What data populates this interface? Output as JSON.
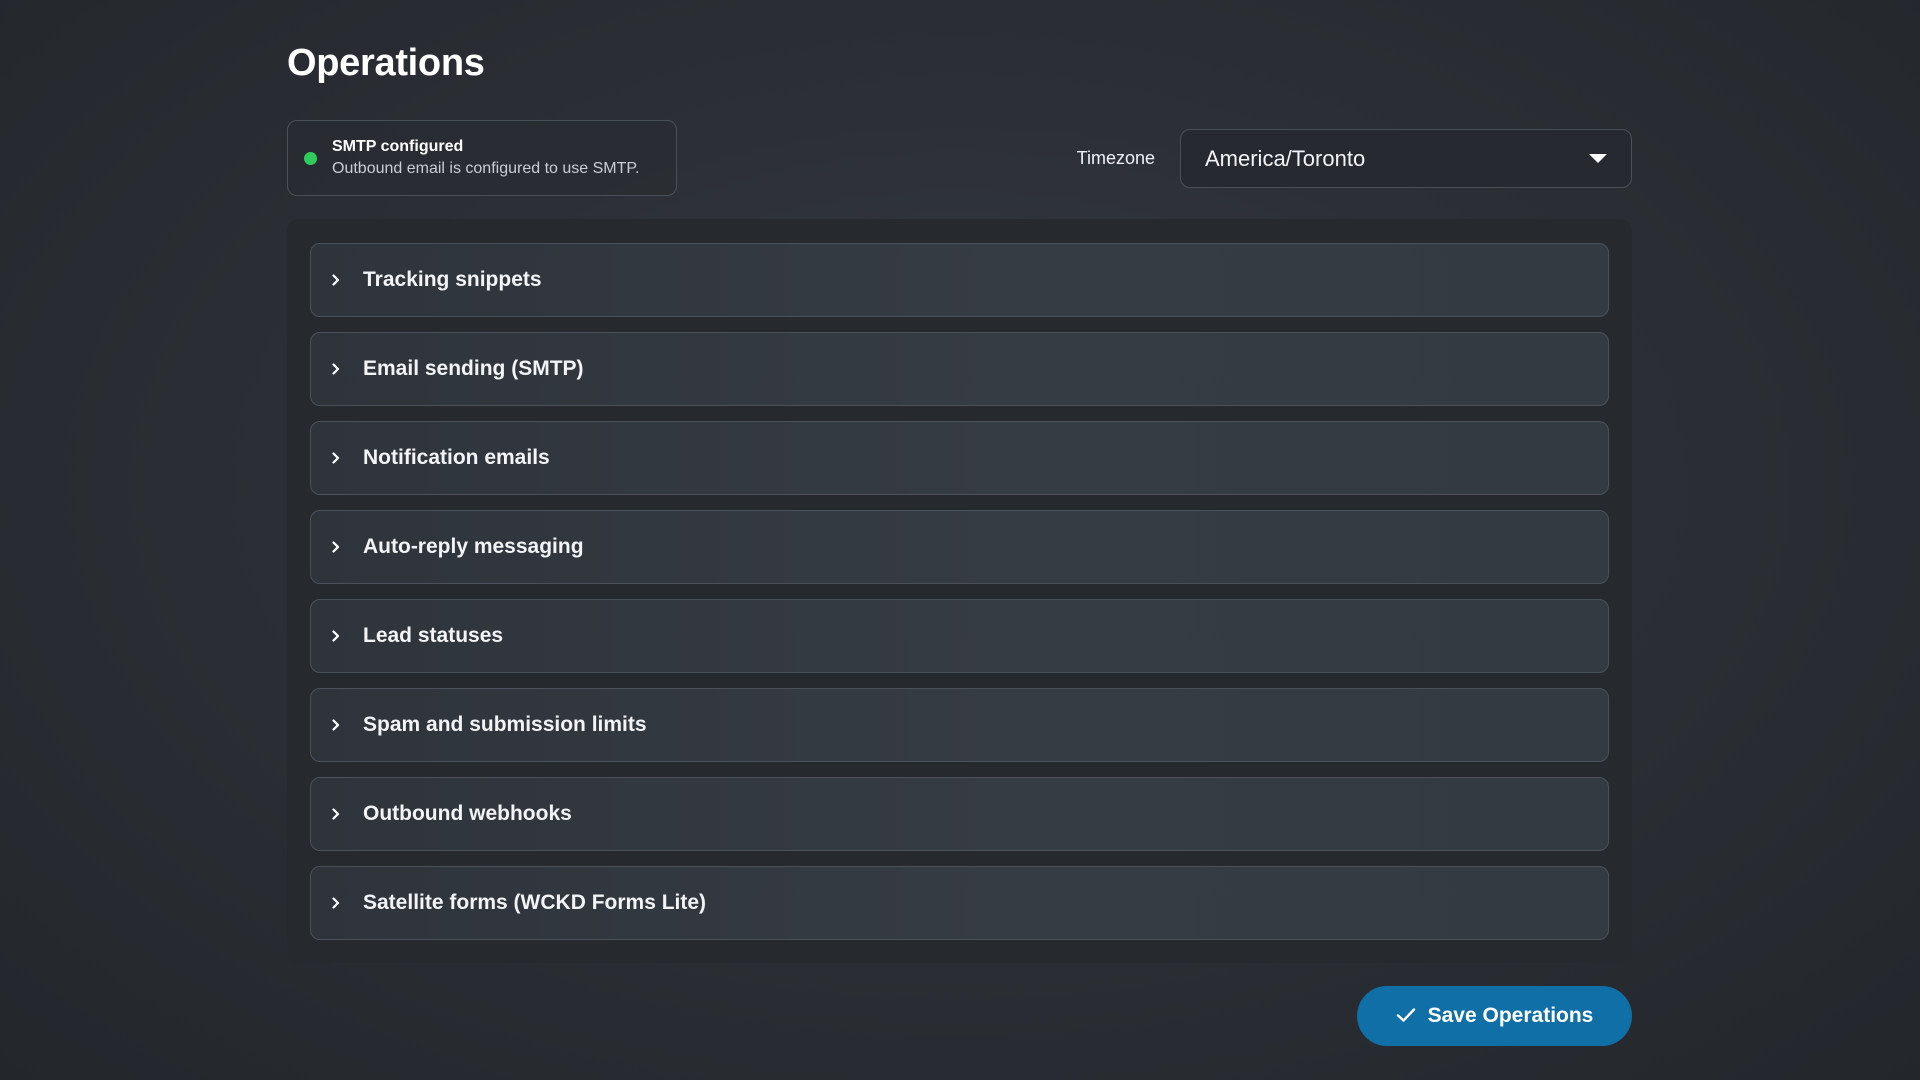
{
  "page": {
    "title": "Operations"
  },
  "smtp_status": {
    "title": "SMTP configured",
    "description": "Outbound email is configured to use SMTP.",
    "status_color": "#2ecc5a"
  },
  "timezone": {
    "label": "Timezone",
    "value": "America/Toronto",
    "icon": "caret-down-icon"
  },
  "sections": [
    {
      "label": "Tracking snippets",
      "icon": "chevron-right-icon",
      "expanded": false
    },
    {
      "label": "Email sending (SMTP)",
      "icon": "chevron-right-icon",
      "expanded": false
    },
    {
      "label": "Notification emails",
      "icon": "chevron-right-icon",
      "expanded": false
    },
    {
      "label": "Auto-reply messaging",
      "icon": "chevron-right-icon",
      "expanded": false
    },
    {
      "label": "Lead statuses",
      "icon": "chevron-right-icon",
      "expanded": false
    },
    {
      "label": "Spam and submission limits",
      "icon": "chevron-right-icon",
      "expanded": false
    },
    {
      "label": "Outbound webhooks",
      "icon": "chevron-right-icon",
      "expanded": false
    },
    {
      "label": "Satellite forms (WCKD Forms Lite)",
      "icon": "chevron-right-icon",
      "expanded": false
    }
  ],
  "save_button": {
    "label": "Save Operations",
    "icon": "check-icon",
    "color": "#0f6fa6"
  }
}
